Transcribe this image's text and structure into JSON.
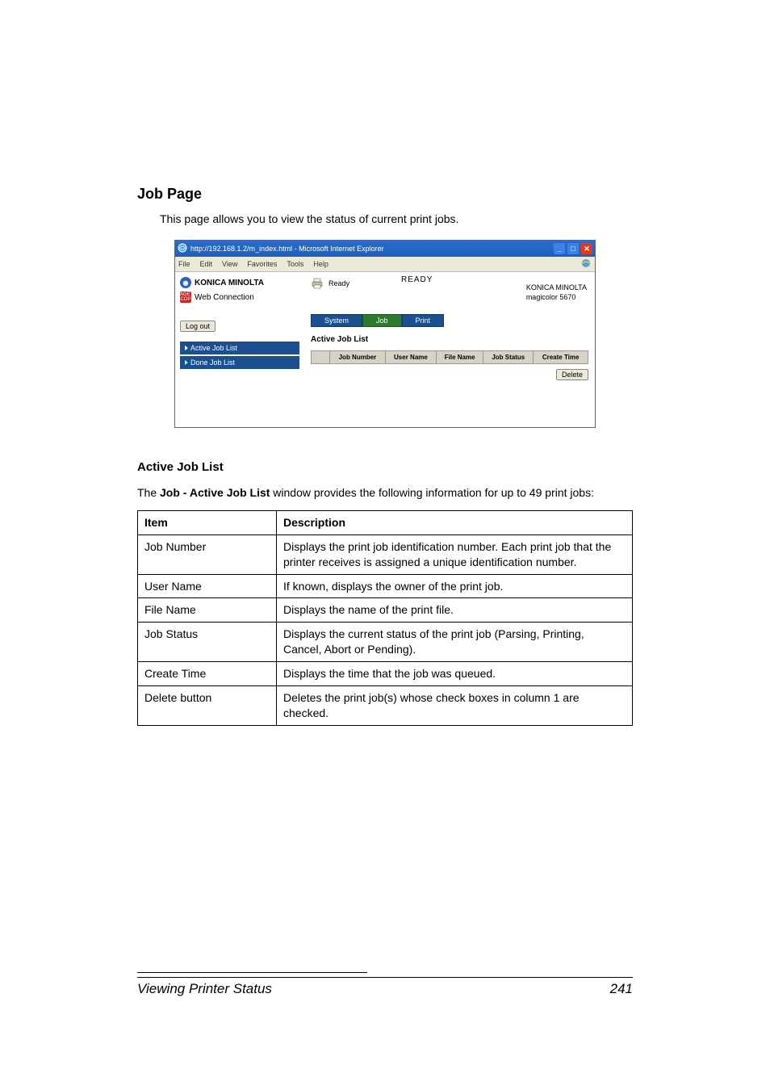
{
  "heading": "Job Page",
  "intro": "This page allows you to view the status of current print jobs.",
  "screenshot": {
    "title": "http://192.168.1.2/m_index.html - Microsoft Internet Explorer",
    "menubar": [
      "File",
      "Edit",
      "View",
      "Favorites",
      "Tools",
      "Help"
    ],
    "brand": "KONICA MINOLTA",
    "pagescope": "Web Connection",
    "pagescope_badge": "PAGE SCOPE",
    "logout": "Log out",
    "side_items": [
      "Active Job List",
      "Done Job List"
    ],
    "ready_small": "Ready",
    "ready_big": "READY",
    "model_line1": "KONICA MINOLTA",
    "model_line2": "magicolor 5670",
    "tabs": [
      "System",
      "Job",
      "Print"
    ],
    "panel_title": "Active Job List",
    "columns": [
      "Job Number",
      "User Name",
      "File Name",
      "Job Status",
      "Create Time"
    ],
    "delete": "Delete"
  },
  "subheading": "Active Job List",
  "paragraph_pre": "The ",
  "paragraph_bold": "Job - Active Job List",
  "paragraph_post": " window provides the following information for up to 49 print jobs:",
  "table": {
    "headers": [
      "Item",
      "Description"
    ],
    "rows": [
      [
        "Job Number",
        "Displays the print job identification number. Each print job that the printer receives is assigned a unique identification number."
      ],
      [
        "User Name",
        "If known, displays the owner of the print job."
      ],
      [
        "File Name",
        "Displays the name of the print file."
      ],
      [
        "Job Status",
        "Displays the current status of the print job (Parsing, Printing, Cancel, Abort or Pending)."
      ],
      [
        "Create Time",
        "Displays the time that the job was queued."
      ],
      [
        "Delete button",
        "Deletes the print job(s) whose check boxes in column 1 are checked."
      ]
    ]
  },
  "footer_left": "Viewing Printer Status",
  "footer_right": "241"
}
